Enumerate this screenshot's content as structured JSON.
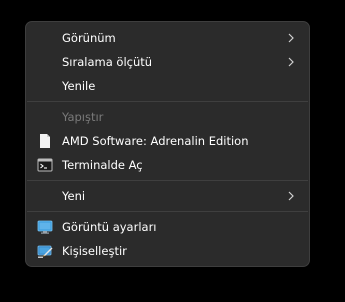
{
  "menu": {
    "items": [
      {
        "label": "Görünüm",
        "submenu": true,
        "enabled": true
      },
      {
        "label": "Sıralama ölçütü",
        "submenu": true,
        "enabled": true
      },
      {
        "label": "Yenile",
        "submenu": false,
        "enabled": true
      },
      {
        "label": "Yapıştır",
        "submenu": false,
        "enabled": false
      },
      {
        "label": "AMD Software: Adrenalin Edition",
        "icon": "document-icon",
        "submenu": false,
        "enabled": true
      },
      {
        "label": "Terminalde Aç",
        "icon": "terminal-icon",
        "submenu": false,
        "enabled": true
      },
      {
        "label": "Yeni",
        "submenu": true,
        "enabled": true
      },
      {
        "label": "Görüntü ayarları",
        "icon": "display-settings-icon",
        "submenu": false,
        "enabled": true
      },
      {
        "label": "Kişiselleştir",
        "icon": "personalize-icon",
        "submenu": false,
        "enabled": true
      }
    ]
  },
  "colors": {
    "menu_background": "#2b2b2b",
    "text": "#ffffff",
    "disabled_text": "#7a7a7a",
    "separator": "#3f3f3f",
    "accent": "#3a9bdc"
  }
}
